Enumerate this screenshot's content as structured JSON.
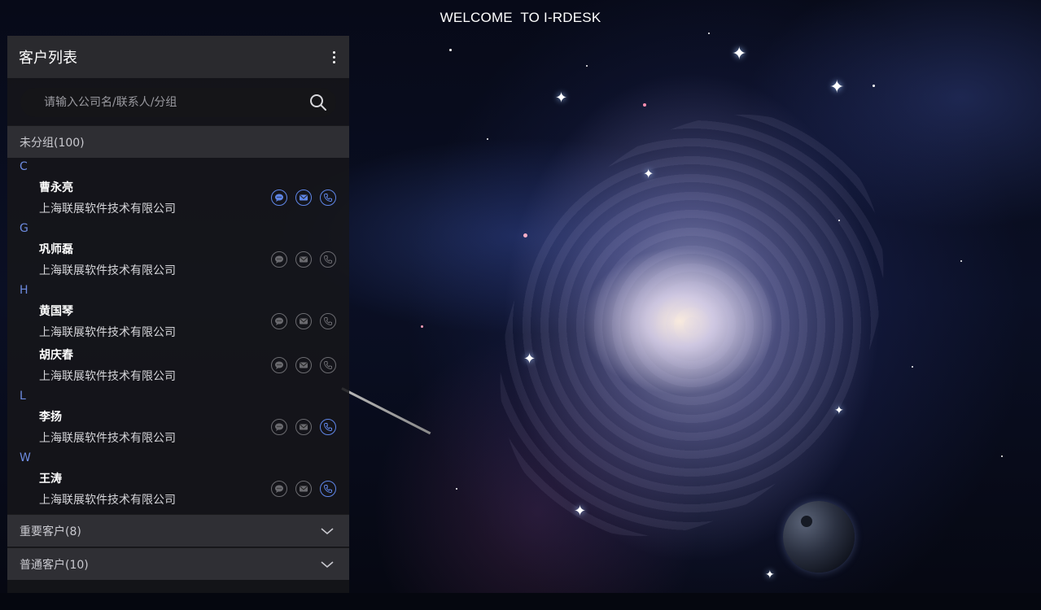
{
  "header": {
    "welcome": "WELCOME  TO I-RDESK"
  },
  "panel": {
    "title": "客户列表",
    "menu_icon": "more-vertical-icon",
    "search": {
      "placeholder": "请输入公司名/联系人/分组",
      "value": "",
      "icon": "search-icon"
    }
  },
  "groups": [
    {
      "label": "未分组(100)",
      "expanded": true
    },
    {
      "label": "重要客户(8)",
      "expanded": false
    },
    {
      "label": "普通客户(10)",
      "expanded": false
    }
  ],
  "contacts": [
    {
      "letter": "C",
      "name": "曹永亮",
      "company": "上海联展软件技术有限公司",
      "chat_active": true,
      "mail_active": true,
      "phone_active": true
    },
    {
      "letter": "G",
      "name": "巩师磊",
      "company": "上海联展软件技术有限公司",
      "chat_active": false,
      "mail_active": false,
      "phone_active": false
    },
    {
      "letter": "H",
      "name": "黄国琴",
      "company": "上海联展软件技术有限公司",
      "chat_active": false,
      "mail_active": false,
      "phone_active": false
    },
    {
      "letter": "",
      "name": "胡庆春",
      "company": "上海联展软件技术有限公司",
      "chat_active": false,
      "mail_active": false,
      "phone_active": false
    },
    {
      "letter": "L",
      "name": "李扬",
      "company": "上海联展软件技术有限公司",
      "chat_active": false,
      "mail_active": false,
      "phone_active": true
    },
    {
      "letter": "W",
      "name": "王涛",
      "company": "上海联展软件技术有限公司",
      "chat_active": false,
      "mail_active": false,
      "phone_active": true
    }
  ],
  "colors": {
    "accent": "#5f86e8",
    "letter": "#6d8be0",
    "inactive": "#6b6b70",
    "panel_bg": "#16161a"
  },
  "icons": {
    "chat": "chat-icon",
    "mail": "mail-icon",
    "phone": "phone-icon",
    "collapse": "chevron-down-icon"
  }
}
